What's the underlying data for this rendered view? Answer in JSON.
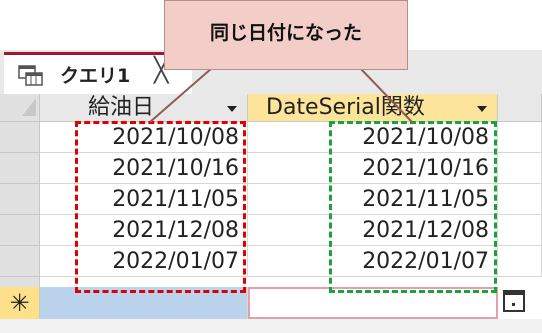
{
  "tab": {
    "label": "クエリ1",
    "close": "╳",
    "icon": "query-icon"
  },
  "columns": [
    {
      "header": "給油日"
    },
    {
      "header": "DateSerial関数"
    }
  ],
  "rows": [
    {
      "c1": "2021/10/08",
      "c2": "2021/10/08"
    },
    {
      "c1": "2021/10/16",
      "c2": "2021/10/16"
    },
    {
      "c1": "2021/11/05",
      "c2": "2021/11/05"
    },
    {
      "c1": "2021/12/08",
      "c2": "2021/12/08"
    },
    {
      "c1": "2022/01/07",
      "c2": "2022/01/07"
    }
  ],
  "new_row_marker": "✳",
  "callout": {
    "text": "同じ日付になった"
  },
  "colors": {
    "accent_red": "#e00000",
    "accent_green": "#1aa33a",
    "header_highlight": "#fde49b",
    "tab_border": "#a5152e"
  }
}
